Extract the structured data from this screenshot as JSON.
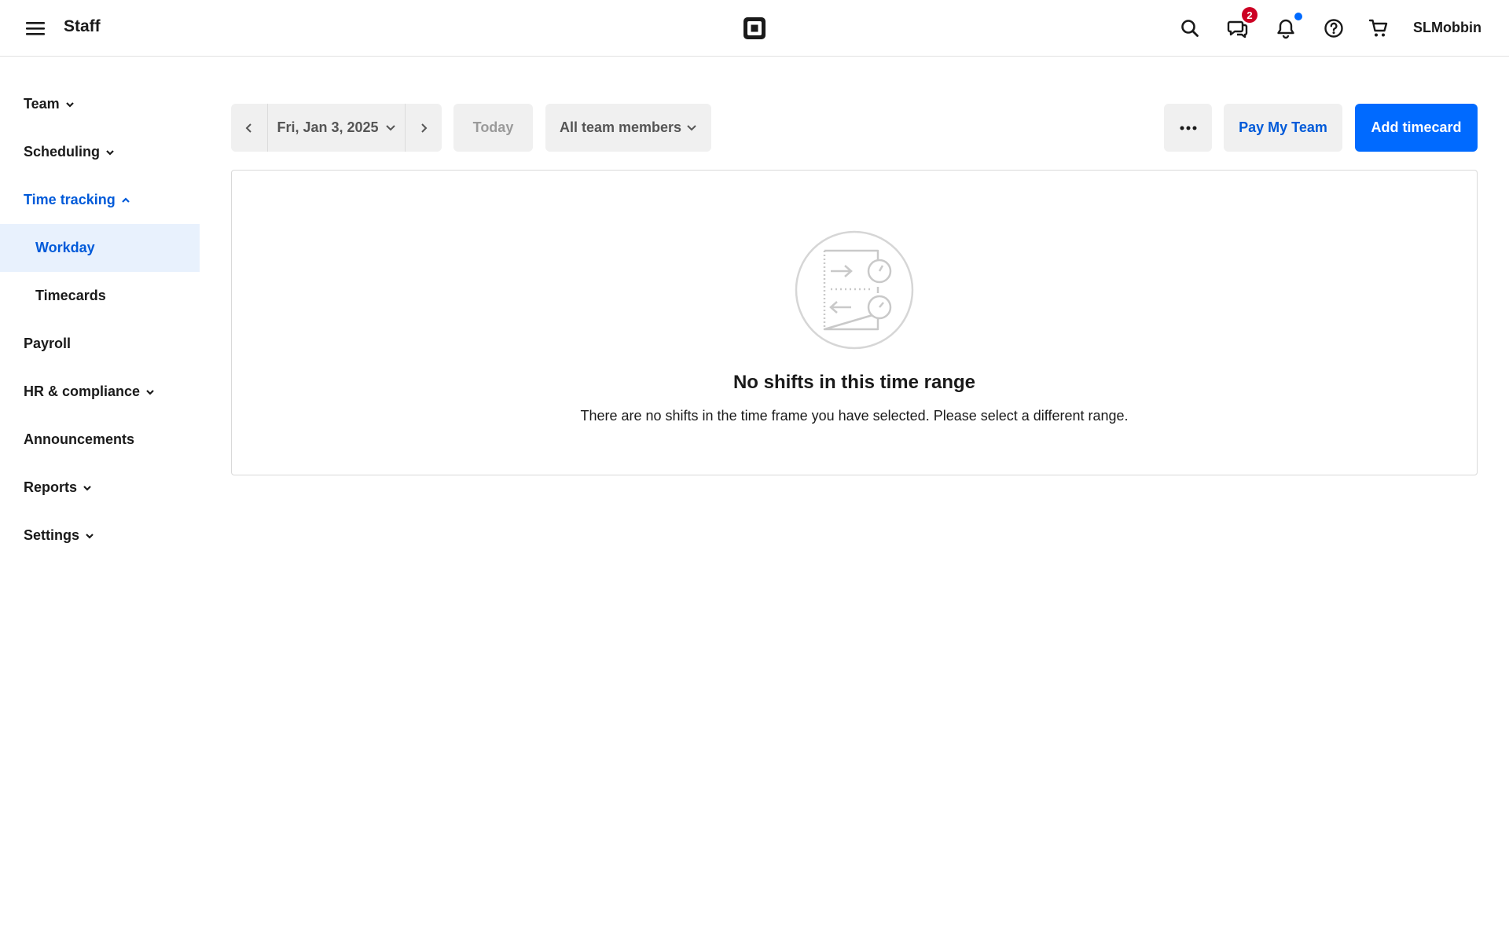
{
  "header": {
    "app_title": "Staff",
    "messages_badge": "2",
    "account_name": "SLMobbin",
    "icons": [
      "menu-icon",
      "square-logo-icon",
      "search-icon",
      "messages-icon",
      "notifications-icon",
      "help-icon",
      "cart-icon"
    ]
  },
  "sidebar": {
    "team": "Team",
    "scheduling": "Scheduling",
    "time_tracking": "Time tracking",
    "workday": "Workday",
    "timecards": "Timecards",
    "payroll": "Payroll",
    "hr_compliance": "HR & compliance",
    "announcements": "Announcements",
    "reports": "Reports",
    "settings": "Settings"
  },
  "toolbar": {
    "date_label": "Fri, Jan 3, 2025",
    "today_label": "Today",
    "filter_label": "All team members",
    "pay_label": "Pay My Team",
    "add_label": "Add timecard"
  },
  "empty_state": {
    "title": "No shifts in this time range",
    "description": "There are no shifts in the time frame you have selected. Please select a different range."
  },
  "colors": {
    "accent": "#006aff",
    "accent_text": "#005ad9",
    "selected_bg": "#e8f1fd",
    "badge_red": "#cc0023"
  }
}
